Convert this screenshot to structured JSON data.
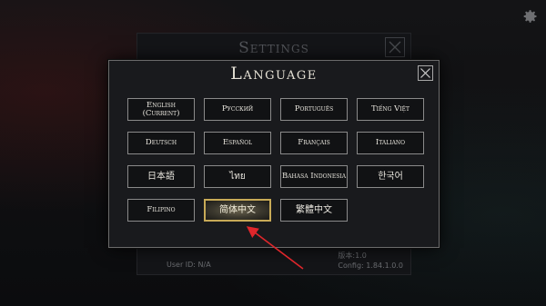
{
  "background": {
    "settings_title": "Settings",
    "user_id": "User ID: N/A",
    "version_line": "版本:1.0",
    "config_line": "Config: 1.84.1.0.0"
  },
  "dialog": {
    "title": "Language",
    "close_icon": "close-icon"
  },
  "languages": [
    {
      "label": "English\n(Current)",
      "selected": false
    },
    {
      "label": "Русский",
      "selected": false
    },
    {
      "label": "Português",
      "selected": false
    },
    {
      "label": "Tiếng Việt",
      "selected": false
    },
    {
      "label": "Deutsch",
      "selected": false
    },
    {
      "label": "Español",
      "selected": false
    },
    {
      "label": "Français",
      "selected": false
    },
    {
      "label": "Italiano",
      "selected": false
    },
    {
      "label": "日本語",
      "selected": false
    },
    {
      "label": "ไทย",
      "selected": false
    },
    {
      "label": "Bahasa Indonesia",
      "selected": false
    },
    {
      "label": "한국어",
      "selected": false
    },
    {
      "label": "Filipino",
      "selected": false
    },
    {
      "label": "简体中文",
      "selected": true
    },
    {
      "label": "繁體中文",
      "selected": false
    }
  ],
  "colors": {
    "selected_border": "#c8aa57",
    "annotation_arrow": "#e0262b"
  }
}
